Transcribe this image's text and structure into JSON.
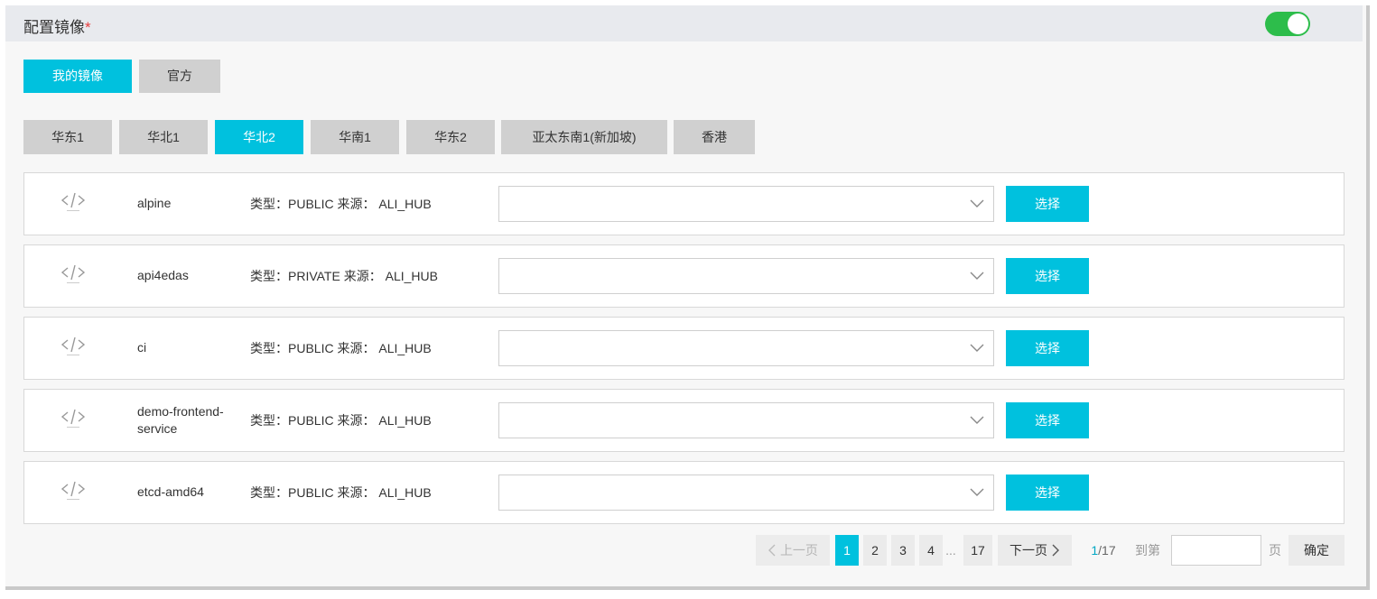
{
  "header": {
    "title": "配置镜像",
    "required_mark": "*",
    "toggle_on": true
  },
  "source_tabs": [
    {
      "label": "我的镜像",
      "active": true
    },
    {
      "label": "官方",
      "active": false
    }
  ],
  "regions": [
    {
      "label": "华东1",
      "active": false
    },
    {
      "label": "华北1",
      "active": false
    },
    {
      "label": "华北2",
      "active": true
    },
    {
      "label": "华南1",
      "active": false
    },
    {
      "label": "华东2",
      "active": false
    },
    {
      "label": "亚太东南1(新加坡)",
      "active": false
    },
    {
      "label": "香港",
      "active": false
    }
  ],
  "images": [
    {
      "name": "alpine",
      "meta": "类型：PUBLIC 来源： ALI_HUB",
      "select_value": "",
      "button": "选择"
    },
    {
      "name": "api4edas",
      "meta": "类型：PRIVATE 来源： ALI_HUB",
      "select_value": "",
      "button": "选择"
    },
    {
      "name": "ci",
      "meta": "类型：PUBLIC 来源： ALI_HUB",
      "select_value": "",
      "button": "选择"
    },
    {
      "name": "demo-frontend-service",
      "meta": "类型：PUBLIC 来源： ALI_HUB",
      "select_value": "",
      "button": "选择"
    },
    {
      "name": "etcd-amd64",
      "meta": "类型：PUBLIC 来源： ALI_HUB",
      "select_value": "",
      "button": "选择"
    }
  ],
  "pagination": {
    "prev": "上一页",
    "pages": [
      "1",
      "2",
      "3",
      "4"
    ],
    "ellipsis": "...",
    "last_page": "17",
    "next": "下一页",
    "current": "1",
    "total_label": "/17",
    "goto_label": "到第",
    "page_unit": "页",
    "goto_value": "",
    "confirm": "确定"
  },
  "colors": {
    "accent": "#00c1de",
    "toggle": "#2dbd4b",
    "required": "#e83e3e"
  }
}
